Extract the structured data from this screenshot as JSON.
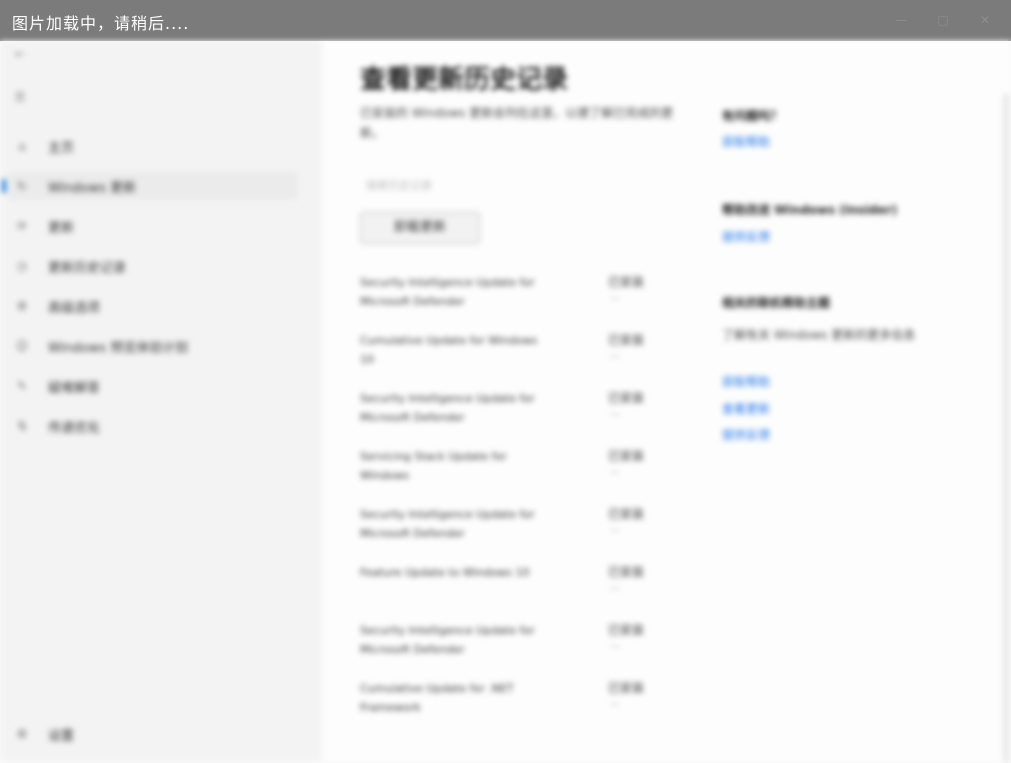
{
  "window": {
    "loading_text": "图片加载中，请稍后....",
    "controls": {
      "minimize": "—",
      "maximize": "□",
      "close": "✕"
    }
  },
  "sidebar": {
    "back_icon": "back-arrow-icon",
    "menu_icon": "hamburger-menu-icon",
    "items": [
      {
        "icon": "home-icon",
        "label": "主页",
        "active": false
      },
      {
        "icon": "sync-icon",
        "label": "Windows 更新",
        "active": true
      },
      {
        "icon": "update-icon",
        "label": "更新",
        "active": false
      },
      {
        "icon": "history-icon",
        "label": "更新历史记录",
        "active": false
      },
      {
        "icon": "options-icon",
        "label": "高级选项",
        "active": false
      },
      {
        "icon": "insider-icon",
        "label": "Windows 预览体验计划",
        "active": false
      },
      {
        "icon": "troubleshoot-icon",
        "label": "疑难解答",
        "active": false
      },
      {
        "icon": "delivery-icon",
        "label": "传递优化",
        "active": false
      }
    ],
    "footer_icon": "settings-icon",
    "footer_label": "设置"
  },
  "main": {
    "title": "查看更新历史记录",
    "description": "已安装的 Windows 更新会列在这里，以便了解已完成的更新。",
    "search_hint": "搜索历史记录",
    "clear_button": "卸载更新",
    "updates": [
      {
        "name": "Security Intelligence Update for Microsoft Defender",
        "status": "已安装",
        "dash": "—"
      },
      {
        "name": "Cumulative Update for Windows 10",
        "status": "已安装",
        "dash": "—"
      },
      {
        "name": "Security Intelligence Update for Microsoft Defender",
        "status": "已安装",
        "dash": "—"
      },
      {
        "name": "Servicing Stack Update for Windows",
        "status": "已安装",
        "dash": "—"
      },
      {
        "name": "Security Intelligence Update for Microsoft Defender",
        "status": "已安装",
        "dash": "—"
      },
      {
        "name": "Feature Update to Windows 10",
        "status": "已安装",
        "dash": "—"
      },
      {
        "name": "Security Intelligence Update for Microsoft Defender",
        "status": "已安装",
        "dash": "—"
      },
      {
        "name": "Cumulative Update for .NET Framework",
        "status": "已安装",
        "dash": "—"
      }
    ]
  },
  "right_panel": {
    "section1_title": "有问题吗？",
    "section1_link": "获取帮助",
    "section2_title": "帮助改进 Windows (Insider)",
    "section2_link": "提供反馈",
    "section3_title": "相关的联机帮助主题",
    "section3_text": "了解有关 Windows 更新的更多信息",
    "links": [
      "获取帮助",
      "查看更新",
      "提供反馈"
    ]
  }
}
